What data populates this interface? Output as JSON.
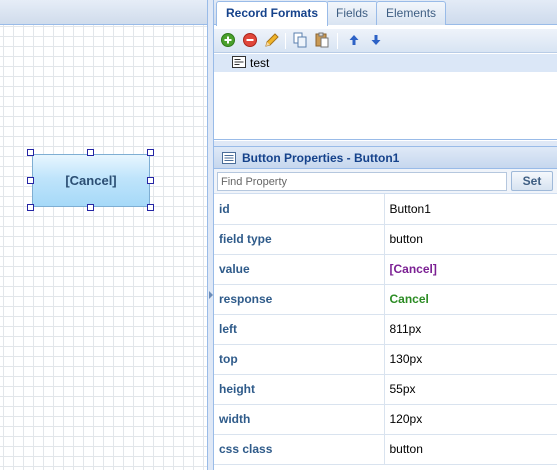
{
  "canvas": {
    "button_label": "[Cancel]"
  },
  "tabs": [
    {
      "label": "Record Formats",
      "active": true
    },
    {
      "label": "Fields",
      "active": false
    },
    {
      "label": "Elements",
      "active": false
    }
  ],
  "toolbar": {
    "buttons": [
      "add-icon",
      "remove-icon",
      "edit-pencil-icon",
      "copy-icon",
      "paste-icon",
      "move-up-icon",
      "move-down-icon"
    ]
  },
  "tree": {
    "items": [
      {
        "label": "test",
        "icon": "record-format-icon"
      }
    ]
  },
  "properties_panel": {
    "title": "Button Properties - Button1",
    "find_placeholder": "Find Property",
    "set_label": "Set",
    "rows": [
      {
        "key": "id",
        "value": "Button1"
      },
      {
        "key": "field type",
        "value": "button"
      },
      {
        "key": "value",
        "value": "[Cancel]"
      },
      {
        "key": "response",
        "value": "Cancel"
      },
      {
        "key": "left",
        "value": "811px"
      },
      {
        "key": "top",
        "value": "130px"
      },
      {
        "key": "height",
        "value": "55px"
      },
      {
        "key": "width",
        "value": "120px"
      },
      {
        "key": "css class",
        "value": "button"
      }
    ]
  },
  "colors": {
    "accent": "#15428b",
    "property_key": "#2f5b8a",
    "value_purple": "#7b2093",
    "value_green": "#2c8c24",
    "design_button_fill": "#bfe4fb"
  }
}
